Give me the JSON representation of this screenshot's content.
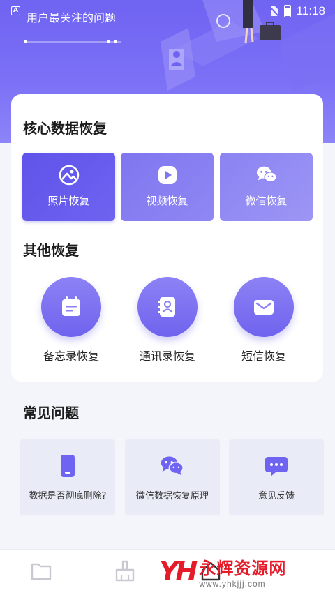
{
  "status_bar": {
    "app_icon_letter": "A",
    "time": "11:18"
  },
  "header": {
    "title": "用户最关注的问题"
  },
  "core_section": {
    "title": "核心数据恢复",
    "items": [
      {
        "label": "照片恢复",
        "icon": "image-icon"
      },
      {
        "label": "视频恢复",
        "icon": "play-icon"
      },
      {
        "label": "微信恢复",
        "icon": "wechat-icon"
      }
    ]
  },
  "other_section": {
    "title": "其他恢复",
    "items": [
      {
        "label": "备忘录恢复",
        "icon": "memo-icon"
      },
      {
        "label": "通讯录恢复",
        "icon": "contacts-icon"
      },
      {
        "label": "短信恢复",
        "icon": "envelope-icon"
      }
    ]
  },
  "faq_section": {
    "title": "常见问题",
    "items": [
      {
        "label": "数据是否彻底删除?",
        "icon": "phone-icon"
      },
      {
        "label": "微信数据恢复原理",
        "icon": "chat-bubbles-icon"
      },
      {
        "label": "意见反馈",
        "icon": "feedback-icon"
      }
    ]
  },
  "bottom_nav": {
    "items": [
      {
        "icon": "folder-icon"
      },
      {
        "icon": "broom-icon"
      },
      {
        "icon": "home-icon"
      }
    ]
  },
  "watermark": {
    "logo": "YH",
    "name": "永辉资源网",
    "url": "www.yhkjjj.com"
  },
  "colors": {
    "accent": "#6f63f2",
    "background": "#f4f5fa",
    "watermark": "#e41c2a"
  }
}
